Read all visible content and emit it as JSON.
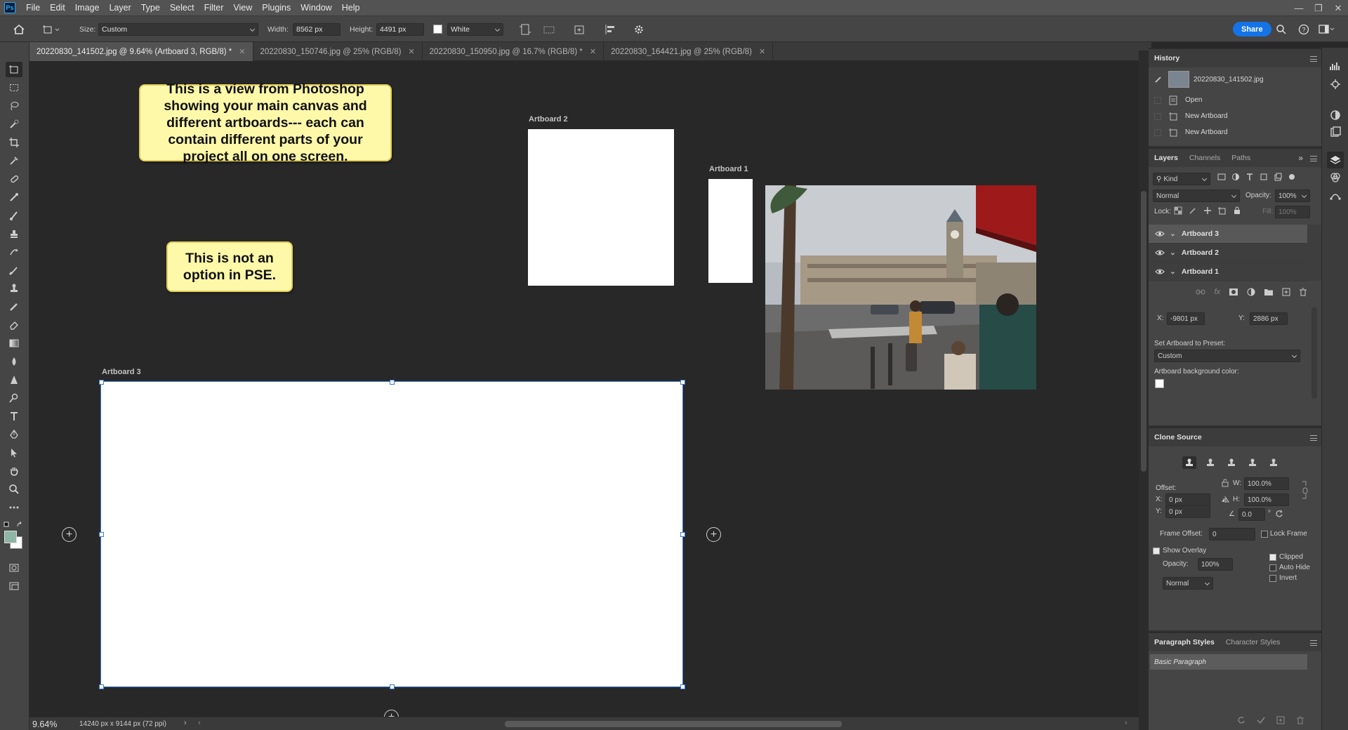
{
  "app": {
    "logo": "Ps"
  },
  "menu": [
    "File",
    "Edit",
    "Image",
    "Layer",
    "Type",
    "Select",
    "Filter",
    "View",
    "Plugins",
    "Window",
    "Help"
  ],
  "options": {
    "size_label": "Size:",
    "size_value": "Custom",
    "width_label": "Width:",
    "width_value": "8562 px",
    "height_label": "Height:",
    "height_value": "4491 px",
    "color_value": "White",
    "share_label": "Share"
  },
  "tabs": [
    {
      "label": "20220830_141502.jpg @ 9.64% (Artboard 3, RGB/8) *",
      "active": true
    },
    {
      "label": "20220830_150746.jpg @ 25% (RGB/8)",
      "active": false
    },
    {
      "label": "20220830_150950.jpg @ 16.7% (RGB/8) *",
      "active": false
    },
    {
      "label": "20220830_164421.jpg @ 25% (RGB/8)",
      "active": false
    }
  ],
  "canvas": {
    "callout1": "This is a view from Photoshop showing your main canvas and different artboards--- each can contain different parts of your project all on one screen.",
    "callout2": "This is not an option in PSE.",
    "artboard1_label": "Artboard 1",
    "artboard2_label": "Artboard 2",
    "artboard3_label": "Artboard 3"
  },
  "status": {
    "zoom": "9.64%",
    "doc_size": "14240 px x 9144 px (72 ppi)"
  },
  "history": {
    "title": "History",
    "snapshot": "20220830_141502.jpg",
    "steps": [
      "Open",
      "New Artboard",
      "New Artboard"
    ]
  },
  "layers": {
    "tabs": [
      "Layers",
      "Channels",
      "Paths"
    ],
    "kind_label": "Kind",
    "blend_mode": "Normal",
    "opacity_label": "Opacity:",
    "opacity_value": "100%",
    "lock_label": "Lock:",
    "fill_label": "Fill:",
    "fill_value": "100%",
    "items": [
      "Artboard 3",
      "Artboard 2",
      "Artboard 1"
    ]
  },
  "properties": {
    "x_label": "X:",
    "x_value": "-9801 px",
    "y_label": "Y:",
    "y_value": "2886 px",
    "preset_label": "Set Artboard to Preset:",
    "preset_value": "Custom",
    "bg_label": "Artboard background color:"
  },
  "clone": {
    "title": "Clone Source",
    "offset_label": "Offset:",
    "x_label": "X:",
    "x_value": "0 px",
    "y_label": "Y:",
    "y_value": "0 px",
    "w_label": "W:",
    "w_value": "100.0%",
    "h_label": "H:",
    "h_value": "100.0%",
    "angle_value": "0.0",
    "frame_offset_label": "Frame Offset:",
    "frame_offset_value": "0",
    "lock_frame_label": "Lock Frame",
    "show_overlay_label": "Show Overlay",
    "opacity_label": "Opacity:",
    "opacity_value": "100%",
    "mode_value": "Normal",
    "clipped_label": "Clipped",
    "auto_hide_label": "Auto Hide",
    "invert_label": "Invert"
  },
  "paragraph": {
    "tabs": [
      "Paragraph Styles",
      "Character Styles"
    ],
    "item": "Basic Paragraph"
  }
}
